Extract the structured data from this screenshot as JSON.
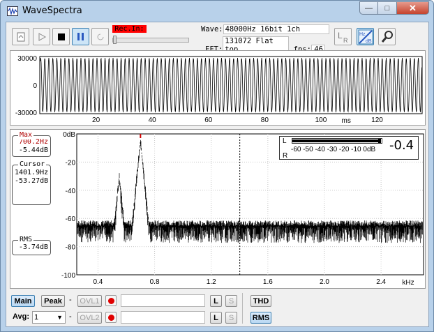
{
  "window": {
    "title": "WaveSpectra",
    "buttons": {
      "minimize": "—",
      "maximize": "□",
      "close": "✕"
    }
  },
  "toolbar": {
    "rec_input_label": "Rec.In:",
    "wave_label": "Wave:",
    "wave_value": "48000Hz 16bit 1ch",
    "fft_label": "FFT:",
    "fft_value": "131072 Flat top",
    "fps_label": "fps:",
    "fps_value": "46",
    "icons": [
      "open-file-icon",
      "play-icon",
      "stop-icon",
      "pause-icon",
      "repeat-icon",
      "lr-channel-icon",
      "hz-db-scale-icon",
      "wrench-icon"
    ]
  },
  "waveform": {
    "y_ticks": [
      "30000",
      "0",
      "-30000"
    ],
    "x_ticks": [
      "20",
      "40",
      "60",
      "80",
      "100",
      "120"
    ],
    "x_unit": "ms"
  },
  "spectrum": {
    "y_ticks": [
      "0dB",
      "-20",
      "-40",
      "-60",
      "-80",
      "-100"
    ],
    "x_ticks": [
      "0.4",
      "0.8",
      "1.2",
      "1.6",
      "2.0",
      "2.4"
    ],
    "x_unit": "kHz",
    "max": {
      "caption": "Max",
      "freq": "700.2Hz",
      "level": "-5.44dB"
    },
    "cursor": {
      "caption": "Cursor",
      "freq": "1401.9Hz",
      "level": "-53.27dB"
    },
    "rms": {
      "caption": "RMS",
      "level": "-3.74dB"
    },
    "meter": {
      "left_label": "L",
      "right_label": "R",
      "scale": "-60 -50 -40 -30 -20 -10 0dB",
      "readout": "-0.4",
      "level_db": -0.4
    }
  },
  "chart_data": {
    "type": "line",
    "xlabel": "kHz",
    "ylabel": "",
    "xlim": [
      0.25,
      2.7
    ],
    "ylim": [
      -100,
      0
    ],
    "series": [
      {
        "x": [
          0.3,
          0.4,
          0.5,
          0.55,
          0.6,
          0.65,
          0.7,
          0.75,
          0.8,
          1.0,
          1.2,
          1.4,
          1.6,
          1.8,
          2.0,
          2.1,
          2.2,
          2.4,
          2.6
        ],
        "values": [
          -85,
          -80,
          -70,
          -30,
          -70,
          -70,
          -5.4,
          -55,
          -62,
          -72,
          -76,
          -50,
          -82,
          -83,
          -84,
          -62,
          -86,
          -87,
          -88
        ]
      }
    ]
  },
  "bottom": {
    "main_label": "Main",
    "peak_label": "Peak",
    "ovl1_label": "OVL1",
    "ovl2_label": "OVL2",
    "avg_label": "Avg:",
    "avg_value": "1",
    "l_label": "L",
    "s_label": "S",
    "thd_label": "THD",
    "rms_label": "RMS",
    "dash": "-"
  }
}
